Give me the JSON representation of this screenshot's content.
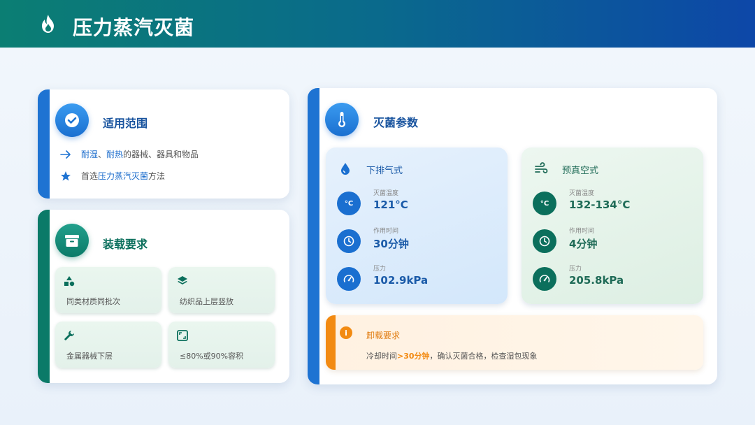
{
  "header": {
    "title": "压力蒸汽灭菌",
    "icon": "flame-icon"
  },
  "scope": {
    "title": "适用范围",
    "icon": "check-circle-icon",
    "line1": {
      "hl1": "耐湿",
      "sep": "、",
      "hl2": "耐热",
      "rest": "的器械、器具和物品",
      "icon": "arrow-right-icon"
    },
    "line2": {
      "pre": "首选",
      "hl": "压力蒸汽灭菌",
      "post": "方法",
      "icon": "star-icon"
    }
  },
  "loading": {
    "title": "装载要求",
    "icon": "archive-box-icon",
    "tiles": [
      {
        "label": "同类材质同批次",
        "icon": "shapes-icon"
      },
      {
        "label": "纺织品上层竖放",
        "icon": "layers-icon"
      },
      {
        "label": "金属器械下层",
        "icon": "wrench-icon"
      },
      {
        "label": "≤80%或90%容积",
        "icon": "expand-icon"
      }
    ]
  },
  "params": {
    "title": "灭菌参数",
    "icon": "thermometer-icon",
    "modes": [
      {
        "name": "下排气式",
        "icon": "droplet-icon",
        "rows": [
          {
            "label": "灭菌温度",
            "value": "121°C",
            "icon_text": "°C"
          },
          {
            "label": "作用时间",
            "value": "30分钟"
          },
          {
            "label": "压力",
            "value": "102.9kPa"
          }
        ]
      },
      {
        "name": "预真空式",
        "icon": "wind-icon",
        "rows": [
          {
            "label": "灭菌温度",
            "value": "132-134°C",
            "icon_text": "°C"
          },
          {
            "label": "作用时间",
            "value": "4分钟"
          },
          {
            "label": "压力",
            "value": "205.8kPa"
          }
        ]
      }
    ],
    "unload": {
      "title": "卸载要求",
      "icon_text": "i",
      "pre": "冷却时间",
      "highlight": ">30分钟",
      "post": "，确认灭菌合格，检查湿包现象"
    }
  },
  "colors": {
    "blue": "#1e73d2",
    "green": "#0b7a68",
    "orange": "#f28a12"
  }
}
